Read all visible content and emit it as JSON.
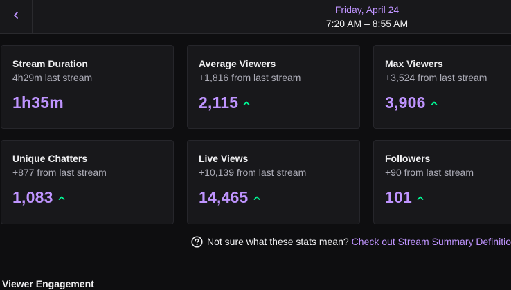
{
  "header": {
    "back_icon": "chevron-left-icon",
    "date": "Friday, April 24",
    "time_range": "7:20 AM – 8:55 AM"
  },
  "stats": [
    {
      "title": "Stream Duration",
      "change": "4h29m last stream",
      "value": "1h35m",
      "trend": "none"
    },
    {
      "title": "Average Viewers",
      "change": "+1,816 from last stream",
      "value": "2,115",
      "trend": "up"
    },
    {
      "title": "Max Viewers",
      "change": "+3,524 from last stream",
      "value": "3,906",
      "trend": "up"
    },
    {
      "title": "Unique Chatters",
      "change": "+877 from last stream",
      "value": "1,083",
      "trend": "up"
    },
    {
      "title": "Live Views",
      "change": "+10,139 from last stream",
      "value": "14,465",
      "trend": "up"
    },
    {
      "title": "Followers",
      "change": "+90 from last stream",
      "value": "101",
      "trend": "up"
    }
  ],
  "help": {
    "icon": "question-circle-icon",
    "text": "Not sure what these stats mean?",
    "link": "Check out Stream Summary Definitions"
  },
  "section": {
    "title": "Viewer Engagement"
  },
  "colors": {
    "accent": "#bf94ff",
    "trend_up": "#00f593",
    "background": "#0e0e10",
    "card": "#18181b"
  }
}
